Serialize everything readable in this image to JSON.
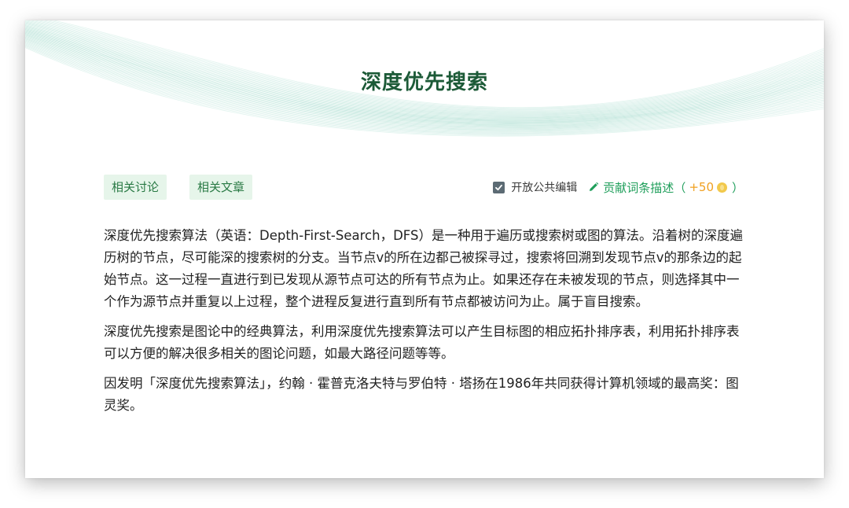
{
  "page": {
    "title": "深度优先搜索"
  },
  "tags": {
    "discussion": "相关讨论",
    "articles": "相关文章"
  },
  "toolbar": {
    "open_edit_label": "开放公共编辑",
    "open_edit_checked": true,
    "contribute_label": "贡献词条描述",
    "paren_open": "（",
    "reward": "+50",
    "paren_close": "）"
  },
  "content": {
    "paragraphs": [
      "深度优先搜索算法（英语：Depth-First-Search，DFS）是一种用于遍历或搜索树或图的算法。沿着树的深度遍历树的节点，尽可能深的搜索树的分支。当节点v的所在边都己被探寻过，搜索将回溯到发现节点v的那条边的起始节点。这一过程一直进行到已发现从源节点可达的所有节点为止。如果还存在未被发现的节点，则选择其中一个作为源节点并重复以上过程，整个进程反复进行直到所有节点都被访问为止。属于盲目搜索。",
      "深度优先搜索是图论中的经典算法，利用深度优先搜索算法可以产生目标图的相应拓扑排序表，利用拓扑排序表可以方便的解决很多相关的图论问题，如最大路径问题等等。",
      "因发明「深度优先搜索算法」，约翰 · 霍普克洛夫特与罗伯特 · 塔扬在1986年共同获得计算机领域的最高奖：图灵奖。"
    ]
  },
  "colors": {
    "title": "#1c5a37",
    "tag_bg": "#e6f5ea",
    "tag_text": "#2a7a45",
    "accent_green": "#1e9e5a",
    "reward_orange": "#f0a020",
    "wave_line": "#bfe6dc"
  },
  "icons": {
    "checkbox": "checkbox-checked-icon",
    "edit": "pencil-icon",
    "coin": "coin-icon"
  }
}
